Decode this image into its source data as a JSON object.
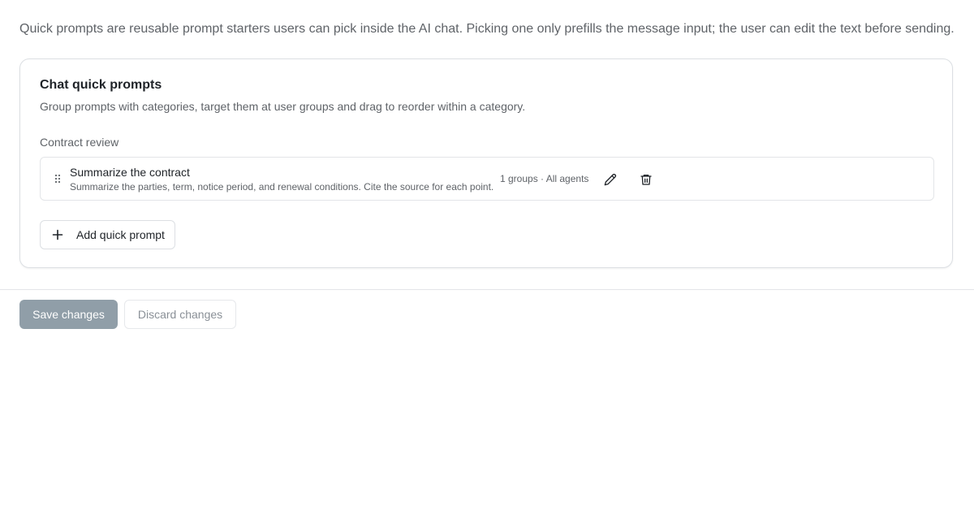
{
  "intro": {
    "text": "Quick prompts are reusable prompt starters users can pick inside the AI chat. Picking one only prefills the message input; the user can edit the text before sending."
  },
  "card": {
    "title": "Chat quick prompts",
    "description": "Group prompts with categories, target them at user groups and drag to reorder within a category.",
    "categories": [
      {
        "label": "Contract review",
        "prompts": [
          {
            "title": "Summarize the contract",
            "body": "Summarize the parties, term, notice period, and renewal conditions. Cite the source for each point.",
            "meta": "1 groups · All agents",
            "icons": {
              "drag": "drag-handle-icon",
              "edit": "pencil-icon",
              "delete": "trash-icon"
            }
          }
        ]
      }
    ],
    "add_label": "Add quick prompt",
    "add_icon": "plus-icon"
  },
  "footer": {
    "save_label": "Save changes",
    "discard_label": "Discard changes"
  },
  "colors": {
    "save_button_bg": "#909ea8",
    "text_primary": "#1f2328",
    "text_secondary": "#5f6368",
    "border": "#dcdfe3"
  }
}
